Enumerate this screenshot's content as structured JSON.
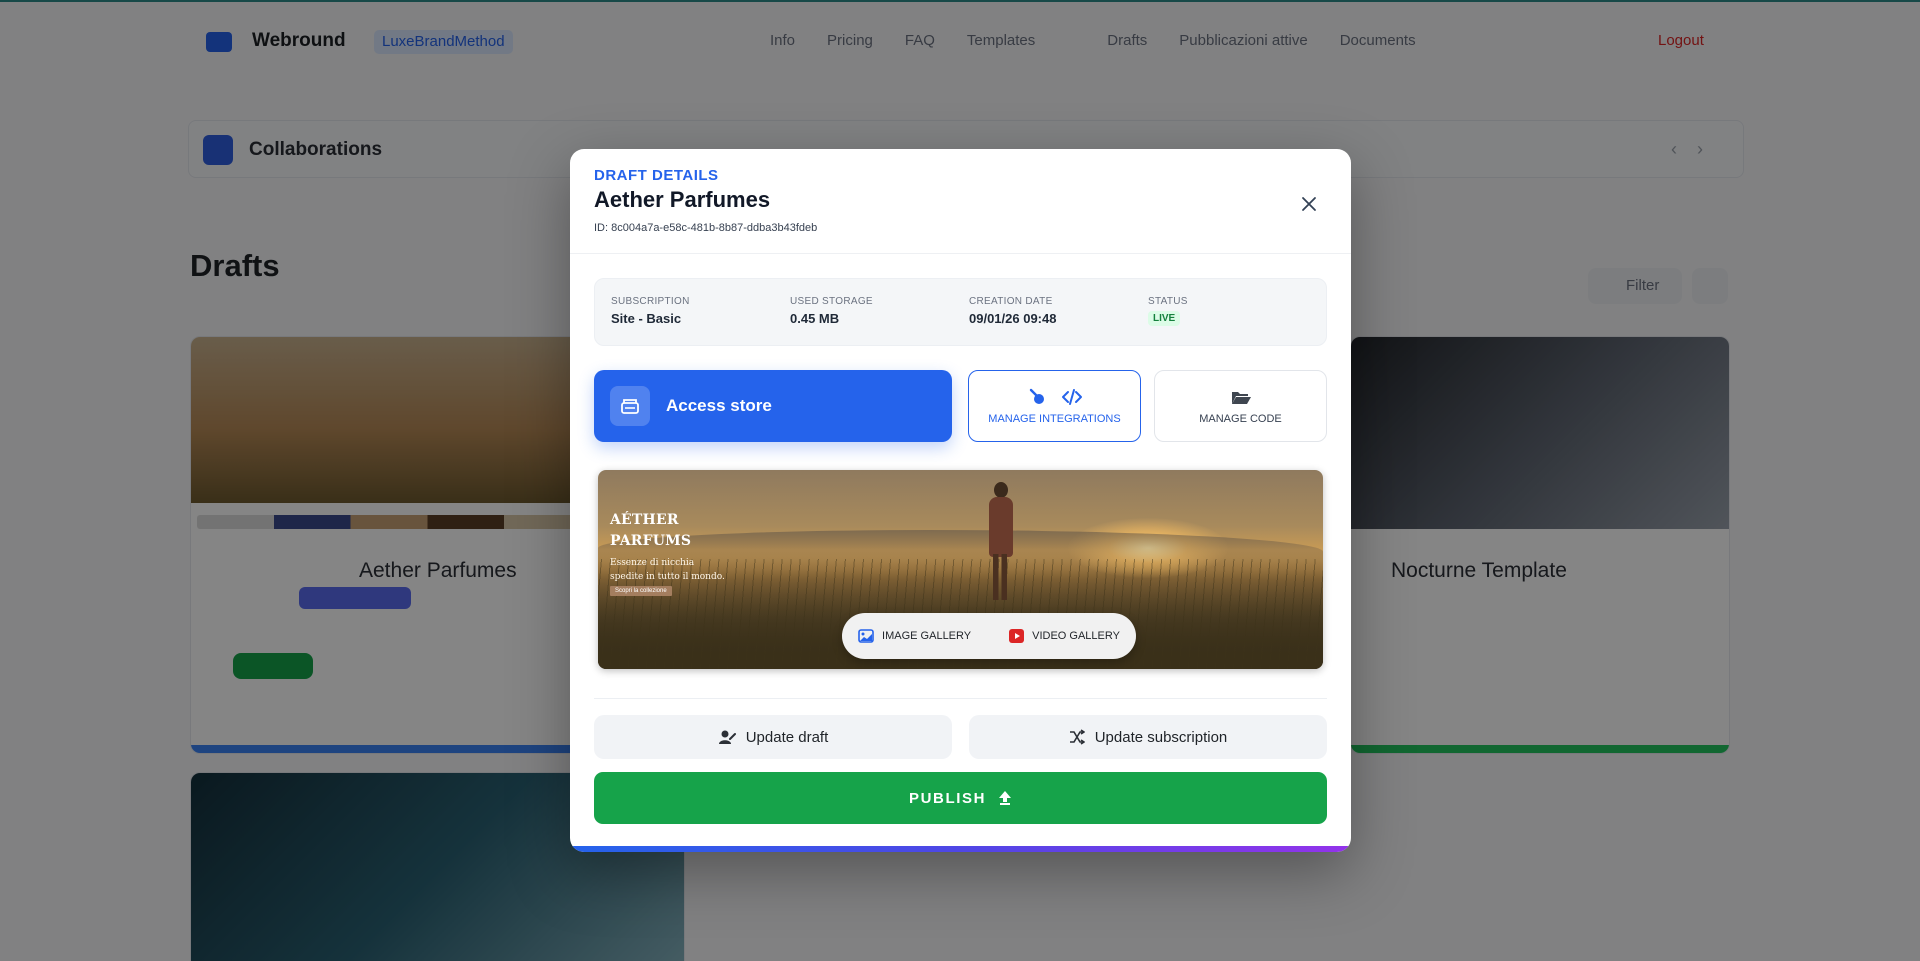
{
  "background": {
    "brand": "Webround",
    "workspace_pill": "LuxeBrandMethod",
    "nav": [
      "Info",
      "Pricing",
      "FAQ",
      "Templates",
      "Drafts",
      "Pubblicazioni attive",
      "Documents"
    ],
    "logout": "Logout",
    "collaborations_title": "Collaborations",
    "drafts_title": "Drafts",
    "filter_label": "Filter",
    "cards": [
      {
        "title": "Aether Parfumes"
      },
      {
        "title": "Nocturne Template"
      }
    ]
  },
  "modal": {
    "eyebrow": "DRAFT DETAILS",
    "title": "Aether Parfumes",
    "id_text": "ID: 8c004a7a-e58c-481b-8b87-ddba3b43fdeb",
    "info": {
      "subscription_label": "SUBSCRIPTION",
      "subscription_value": "Site - Basic",
      "storage_label": "USED STORAGE",
      "storage_value": "0.45 MB",
      "created_label": "CREATION DATE",
      "created_value": "09/01/26 09:48",
      "status_label": "STATUS",
      "status_value": "LIVE"
    },
    "access_store_label": "Access store",
    "manage_integrations_label": "MANAGE INTEGRATIONS",
    "manage_code_label": "MANAGE CODE",
    "preview": {
      "brand_line1": "AÉTHER",
      "brand_line2": "PARFUMS",
      "tagline": "Essenze di nicchia spedite in tutto il mondo.",
      "cta": "Scopri la collezione",
      "image_gallery_label": "IMAGE GALLERY",
      "video_gallery_label": "VIDEO GALLERY"
    },
    "update_draft_label": "Update draft",
    "update_subscription_label": "Update subscription",
    "publish_label": "PUBLISH"
  },
  "colors": {
    "accent": "#2563eb",
    "publish": "#16a34a",
    "live_badge_bg": "#dcfce7",
    "live_badge_text": "#15803d"
  },
  "icons": {
    "close": "close-icon",
    "access_store": "store-icon",
    "integrations": [
      "plug-icon",
      "code-icon"
    ],
    "manage_code": "folder-open-icon",
    "image_gallery": "image-icon",
    "video_gallery": "video-icon",
    "update_draft": "user-edit-icon",
    "update_subscription": "shuffle-icon",
    "publish": "upload-arrow-icon"
  }
}
